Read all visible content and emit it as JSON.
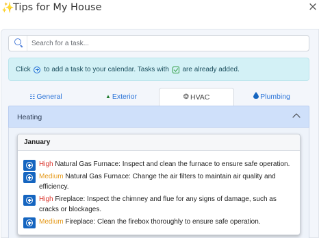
{
  "window": {
    "title": "Tips for My House",
    "title_icon": "sparkle-icon",
    "close_label": "×"
  },
  "search": {
    "value": "",
    "placeholder": "Search for a task..."
  },
  "info": {
    "part1": "Click",
    "part2": "to add a task to your calendar. Tasks with",
    "part3": "are already added."
  },
  "tabs": [
    {
      "label": "General",
      "icon": "list-icon",
      "icon_glyph": "☷",
      "active": false
    },
    {
      "label": "Exterior",
      "icon": "tree-icon",
      "icon_glyph": "▲",
      "active": false
    },
    {
      "label": "HVAC",
      "icon": "fan-icon",
      "icon_glyph": "❂",
      "active": true
    },
    {
      "label": "Plumbing",
      "icon": "water-drop-icon",
      "icon_glyph": "💧",
      "active": false
    }
  ],
  "accordion": {
    "title": "Heating",
    "expanded": true
  },
  "card": {
    "title": "January",
    "tasks": [
      {
        "priority": "High",
        "text": "Natural Gas Furnace: Inspect and clean the furnace to ensure safe operation."
      },
      {
        "priority": "Medium",
        "text": "Natural Gas Furnace: Change the air filters to maintain air quality and efficiency."
      },
      {
        "priority": "High",
        "text": "Fireplace: Inspect the chimney and flue for any signs of damage, such as cracks or blockages."
      },
      {
        "priority": "Medium",
        "text": "Fireplace: Clean the firebox thoroughly to ensure safe operation."
      }
    ]
  },
  "colors": {
    "high": "#d9342b",
    "medium": "#e59a1c",
    "accent": "#1565c0",
    "info_bg": "#d3f1f6",
    "accordion_bg": "#cfe0fa"
  }
}
